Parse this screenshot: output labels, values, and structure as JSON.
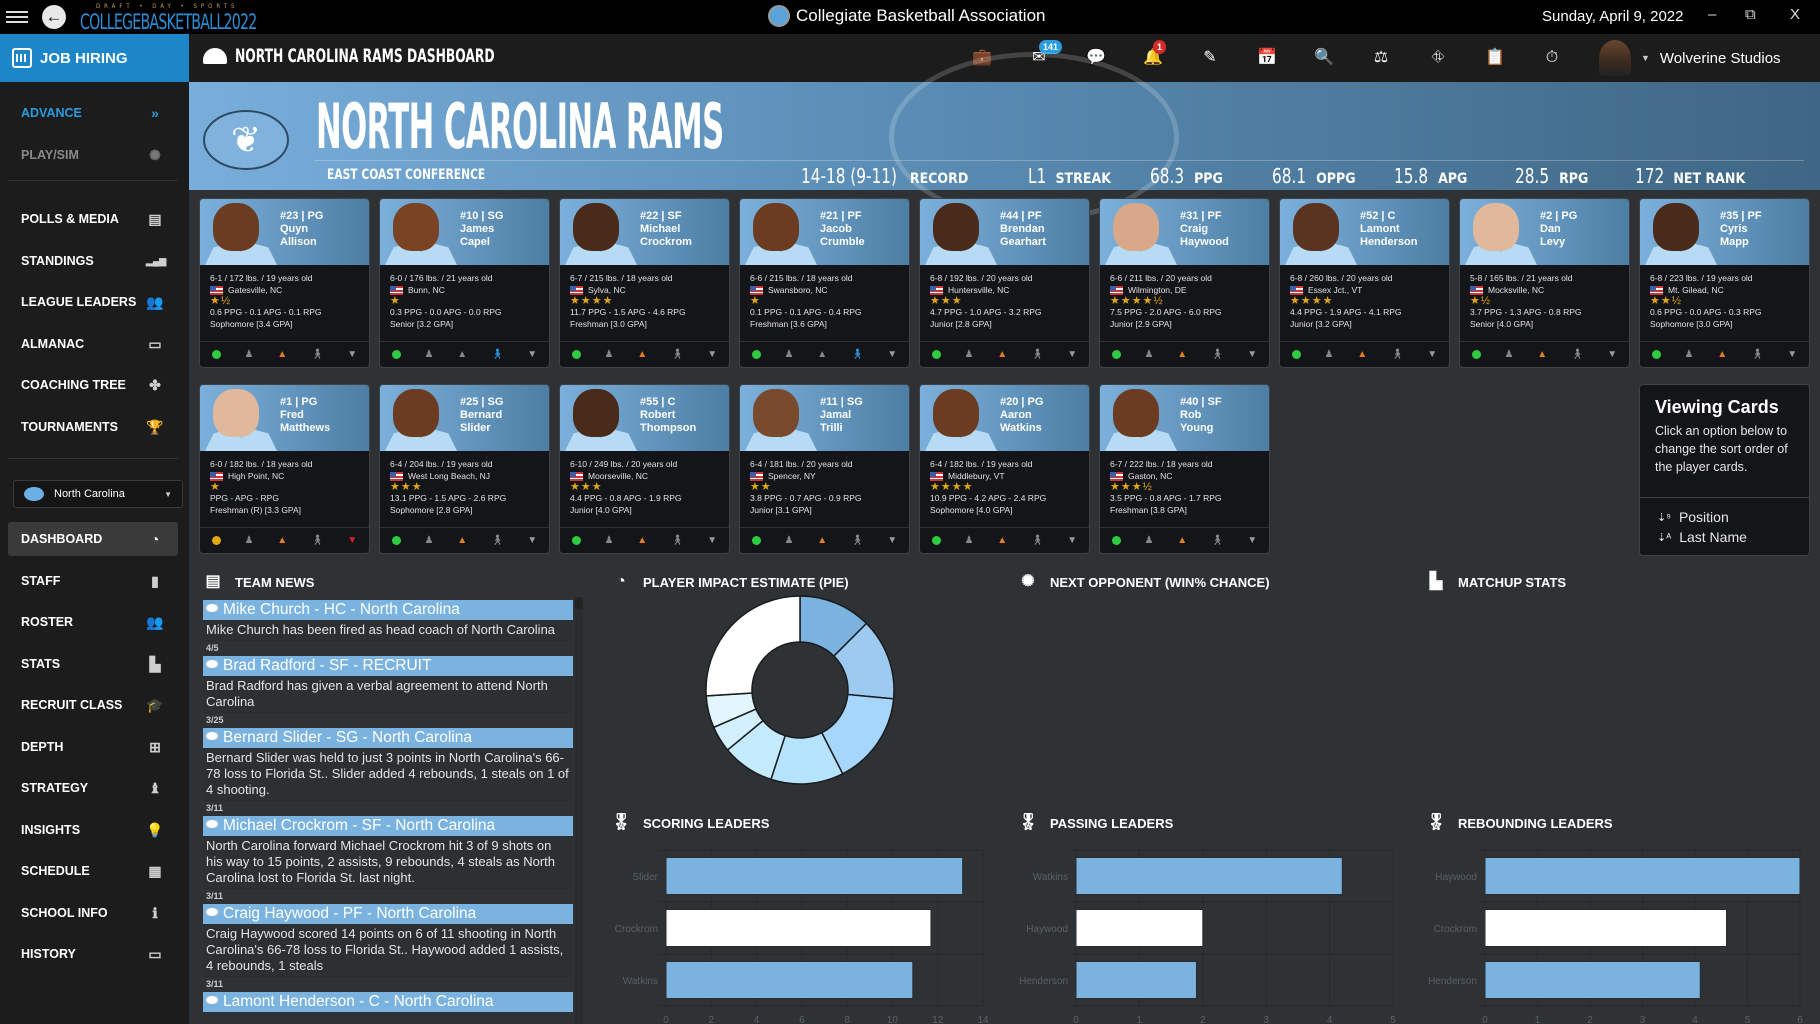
{
  "titlebar": {
    "logo_sup": "DRAFT • DAY • SPORTS",
    "logo_main": "COLLEGEBASKETBALL2022",
    "app_title": "Collegiate Basketball Association",
    "date": "Sunday, April 9, 2022",
    "minimize": "–",
    "restore": "⧉",
    "close": "X"
  },
  "job_hiring": {
    "label": "JOB HIRING"
  },
  "topnav": {
    "title": "NORTH CAROLINA RAMS DASHBOARD",
    "icons": [
      "briefcase-icon",
      "mail-icon",
      "chat-icon",
      "bell-icon",
      "edit-icon",
      "calendar-check-icon",
      "search-icon",
      "scales-icon",
      "road-icon",
      "clipboard-icon",
      "stopwatch-icon"
    ],
    "mail_badge": "141",
    "bell_badge": "1",
    "user_name": "Wolverine Studios",
    "user_caret": "▼"
  },
  "sidebar": {
    "top_items": [
      {
        "label": "ADVANCE",
        "icon": "»"
      },
      {
        "label": "PLAY/SIM",
        "icon": "✺"
      }
    ],
    "league_items": [
      {
        "label": "POLLS & MEDIA",
        "icon": "▤"
      },
      {
        "label": "STANDINGS",
        "icon": "▂▄▆"
      },
      {
        "label": "LEAGUE LEADERS",
        "icon": "👥"
      },
      {
        "label": "ALMANAC",
        "icon": "▭"
      },
      {
        "label": "COACHING TREE",
        "icon": "✤"
      },
      {
        "label": "TOURNAMENTS",
        "icon": "🏆"
      }
    ],
    "team_select": "North Carolina",
    "team_items": [
      {
        "label": "DASHBOARD",
        "icon": "◔"
      },
      {
        "label": "STAFF",
        "icon": "▮"
      },
      {
        "label": "ROSTER",
        "icon": "👥"
      },
      {
        "label": "STATS",
        "icon": "▙"
      },
      {
        "label": "RECRUIT CLASS",
        "icon": "🎓"
      },
      {
        "label": "DEPTH",
        "icon": "⊞"
      },
      {
        "label": "STRATEGY",
        "icon": "♝"
      },
      {
        "label": "INSIGHTS",
        "icon": "💡"
      },
      {
        "label": "SCHEDULE",
        "icon": "▦"
      },
      {
        "label": "SCHOOL INFO",
        "icon": "ℹ"
      },
      {
        "label": "HISTORY",
        "icon": "▭"
      }
    ]
  },
  "banner": {
    "team_name": "NORTH CAROLINA RAMS",
    "conference": "EAST COAST CONFERENCE",
    "stats": [
      {
        "value": "14-18 (9-11)",
        "label": "RECORD"
      },
      {
        "value": "L1",
        "label": "STREAK"
      },
      {
        "value": "68.3",
        "label": "PPG"
      },
      {
        "value": "68.1",
        "label": "OPPG"
      },
      {
        "value": "15.8",
        "label": "APG"
      },
      {
        "value": "28.5",
        "label": "RPG"
      },
      {
        "value": "172",
        "label": "NET RANK"
      }
    ]
  },
  "players": [
    {
      "num_pos": "#23 | PG",
      "first": "Quyn",
      "last": "Allison",
      "bio": "6-1 / 172 lbs. / 19 years old",
      "home": "Gatesville, NC",
      "stars": "★½",
      "stats": "0.6 PPG - 0.1 APG - 0.1 RPG",
      "class": "Sophomore [3.4 GPA]",
      "mood": "#2ecc40",
      "grad": "#e67e22",
      "walk": "#888",
      "shirt": "#999",
      "skin": "#6b3c22"
    },
    {
      "num_pos": "#10 | SG",
      "first": "James",
      "last": "Capel",
      "bio": "6-0 / 176 lbs. / 21 years old",
      "home": "Bunn, NC",
      "stars": "★",
      "stats": "0.3 PPG - 0.0 APG - 0.0 RPG",
      "class": "Senior [3.2 GPA]",
      "mood": "#2ecc40",
      "grad": "#888",
      "walk": "#2a8fd6",
      "shirt": "#999",
      "skin": "#7a4424"
    },
    {
      "num_pos": "#22 | SF",
      "first": "Michael",
      "last": "Crockrom",
      "bio": "6-7 / 215 lbs. / 18 years old",
      "home": "Sylva, NC",
      "stars": "★★★★",
      "stats": "11.7 PPG - 1.5 APG - 4.6 RPG",
      "class": "Freshman [3.0 GPA]",
      "mood": "#2ecc40",
      "grad": "#e67e22",
      "walk": "#888",
      "shirt": "#999",
      "skin": "#4a2a18"
    },
    {
      "num_pos": "#21 | PF",
      "first": "Jacob",
      "last": "Crumble",
      "bio": "6-6 / 215 lbs. / 18 years old",
      "home": "Swansboro, NC",
      "stars": "★",
      "stats": "0.1 PPG - 0.1 APG - 0.4 RPG",
      "class": "Freshman [3.6 GPA]",
      "mood": "#2ecc40",
      "grad": "#888",
      "walk": "#2a8fd6",
      "shirt": "#999",
      "skin": "#6b3c22"
    },
    {
      "num_pos": "#44 | PF",
      "first": "Brendan",
      "last": "Gearhart",
      "bio": "6-8 / 192 lbs. / 20 years old",
      "home": "Huntersville, NC",
      "stars": "★★★",
      "stats": "4.7 PPG - 1.0 APG - 3.2 RPG",
      "class": "Junior [2.8 GPA]",
      "mood": "#2ecc40",
      "grad": "#e67e22",
      "walk": "#888",
      "shirt": "#999",
      "skin": "#4a2a18"
    },
    {
      "num_pos": "#31 | PF",
      "first": "Craig",
      "last": "Haywood",
      "bio": "6-6 / 211 lbs. / 20 years old",
      "home": "Wilmington, DE",
      "stars": "★★★★½",
      "stats": "7.5 PPG - 2.0 APG - 6.0 RPG",
      "class": "Junior [2.9 GPA]",
      "mood": "#2ecc40",
      "grad": "#e67e22",
      "walk": "#888",
      "shirt": "#999",
      "skin": "#d9a88a"
    },
    {
      "num_pos": "#52 | C",
      "first": "Lamont",
      "last": "Henderson",
      "bio": "6-8 / 260 lbs. / 20 years old",
      "home": "Essex Jct., VT",
      "stars": "★★★★",
      "stats": "4.4 PPG - 1.9 APG - 4.1 RPG",
      "class": "Junior [3.2 GPA]",
      "mood": "#2ecc40",
      "grad": "#e67e22",
      "walk": "#888",
      "shirt": "#999",
      "skin": "#5a3420"
    },
    {
      "num_pos": "#2 | PG",
      "first": "Dan",
      "last": "Levy",
      "bio": "5-8 / 165 lbs. / 21 years old",
      "home": "Mocksville, NC",
      "stars": "★½",
      "stats": "3.7 PPG - 1.3 APG - 0.8 RPG",
      "class": "Senior [4.0 GPA]",
      "mood": "#2ecc40",
      "grad": "#e67e22",
      "walk": "#888",
      "shirt": "#999",
      "skin": "#e0b89c"
    },
    {
      "num_pos": "#35 | PF",
      "first": "Cyris",
      "last": "Mapp",
      "bio": "6-8 / 223 lbs. / 19 years old",
      "home": "Mt. Gilead, NC",
      "stars": "★★½",
      "stats": "0.6 PPG - 0.0 APG - 0.3 RPG",
      "class": "Sophomore [3.0 GPA]",
      "mood": "#2ecc40",
      "grad": "#e67e22",
      "walk": "#888",
      "shirt": "#999",
      "skin": "#4a2a18"
    },
    {
      "num_pos": "#1 | PG",
      "first": "Fred",
      "last": "Matthews",
      "bio": "6-0 / 182 lbs. / 18 years old",
      "home": "High Point, NC",
      "stars": "★",
      "stats": "PPG - APG - RPG",
      "class": "Freshman (R) [3.3 GPA]",
      "mood": "#e2a813",
      "grad": "#e67e22",
      "walk": "#888",
      "shirt": "#e02020",
      "skin": "#e0b89c"
    },
    {
      "num_pos": "#25 | SG",
      "first": "Bernard",
      "last": "Slider",
      "bio": "6-4 / 204 lbs. / 19 years old",
      "home": "West Long Beach, NJ",
      "stars": "★★★",
      "stats": "13.1 PPG - 1.5 APG - 2.6 RPG",
      "class": "Sophomore [2.8 GPA]",
      "mood": "#2ecc40",
      "grad": "#e67e22",
      "walk": "#888",
      "shirt": "#999",
      "skin": "#6b3c22"
    },
    {
      "num_pos": "#55 | C",
      "first": "Robert",
      "last": "Thompson",
      "bio": "6-10 / 249 lbs. / 20 years old",
      "home": "Moorseville, NC",
      "stars": "★★★",
      "stats": "4.4 PPG - 0.8 APG - 1.9 RPG",
      "class": "Junior [4.0 GPA]",
      "mood": "#2ecc40",
      "grad": "#e67e22",
      "walk": "#888",
      "shirt": "#999",
      "skin": "#4a2a18"
    },
    {
      "num_pos": "#11 | SG",
      "first": "Jamal",
      "last": "Trilli",
      "bio": "6-4 / 181 lbs. / 20 years old",
      "home": "Spencer, NY",
      "stars": "★★",
      "stats": "3.8 PPG - 0.7 APG - 0.9 RPG",
      "class": "Junior [3.1 GPA]",
      "mood": "#2ecc40",
      "grad": "#e67e22",
      "walk": "#888",
      "shirt": "#999",
      "skin": "#7a4a2c"
    },
    {
      "num_pos": "#20 | PG",
      "first": "Aaron",
      "last": "Watkins",
      "bio": "6-4 / 182 lbs. / 19 years old",
      "home": "Middlebury, VT",
      "stars": "★★★★",
      "stats": "10.9 PPG - 4.2 APG - 2.4 RPG",
      "class": "Sophomore [4.0 GPA]",
      "mood": "#2ecc40",
      "grad": "#e67e22",
      "walk": "#888",
      "shirt": "#999",
      "skin": "#6b3c22"
    },
    {
      "num_pos": "#40 | SF",
      "first": "Rob",
      "last": "Young",
      "bio": "6-7 / 222 lbs. / 18 years old",
      "home": "Gaston, NC",
      "stars": "★★★½",
      "stats": "3.5 PPG - 0.8 APG - 1.7 RPG",
      "class": "Freshman [3.8 GPA]",
      "mood": "#2ecc40",
      "grad": "#e67e22",
      "walk": "#888",
      "shirt": "#999",
      "skin": "#6b3c22"
    }
  ],
  "viewing_cards": {
    "title": "Viewing Cards",
    "text": "Click an option below to change the sort order of the player cards.",
    "options": [
      {
        "icon": "⇣⁹",
        "label": "Position"
      },
      {
        "icon": "⇣ᴬ",
        "label": "Last Name"
      }
    ]
  },
  "sections": {
    "team_news": "TEAM NEWS",
    "pie": "PLAYER IMPACT ESTIMATE (PIE)",
    "next_opponent": "NEXT OPPONENT (WIN% CHANCE)",
    "matchup": "MATCHUP STATS",
    "scoring": "SCORING LEADERS",
    "passing": "PASSING LEADERS",
    "rebounding": "REBOUNDING LEADERS"
  },
  "news": [
    {
      "headline": "Mike Church - HC - North Carolina",
      "body": "Mike Church has been fired as head coach of North Carolina",
      "date": "4/5"
    },
    {
      "headline": "Brad Radford - SF - RECRUIT",
      "body": "Brad Radford has given a verbal agreement to attend North Carolina",
      "date": "3/25"
    },
    {
      "headline": "Bernard Slider - SG - North Carolina",
      "body": "Bernard Slider was held to just 3 points in North Carolina's 66-78 loss to Florida St.. Slider added 4 rebounds, 1 steals on 1 of 4 shooting.",
      "date": "3/11"
    },
    {
      "headline": "Michael Crockrom - SF - North Carolina",
      "body": "North Carolina forward Michael Crockrom hit 3 of 9 shots on his way to 15 points, 2 assists, 9 rebounds, 4 steals as North Carolina lost to Florida St. last night.",
      "date": "3/11"
    },
    {
      "headline": "Craig Haywood - PF - North Carolina",
      "body": "Craig Haywood scored 14 points on 6 of 11 shooting in North Carolina's 66-78 loss to Florida St.. Haywood added 1 assists, 4 rebounds, 1 steals",
      "date": "3/11"
    },
    {
      "headline": "Lamont Henderson - C - North Carolina",
      "body": "",
      "date": ""
    }
  ],
  "chart_data": [
    {
      "type": "pie",
      "title": "PLAYER IMPACT ESTIMATE (PIE)",
      "donut": true,
      "values": [
        12.5,
        14,
        16,
        12.5,
        9,
        4.5,
        5.5,
        26
      ],
      "colors": [
        "#7ab3e0",
        "#9dcaf0",
        "#a6d6fb",
        "#b5e2fc",
        "#c3eafd",
        "#d2f0fe",
        "#e3f6fe",
        "#ffffff"
      ]
    },
    {
      "type": "bar",
      "orientation": "horizontal",
      "title": "SCORING LEADERS",
      "categories": [
        "Slider",
        "Crockrom",
        "Watkins"
      ],
      "values": [
        13.1,
        11.7,
        10.9
      ],
      "colors": [
        "#7ab3e0",
        "#ffffff",
        "#7ab3e0"
      ],
      "xlim": [
        0,
        14
      ],
      "ticks": [
        0,
        2,
        4,
        6,
        8,
        10,
        12,
        14
      ],
      "grid": true
    },
    {
      "type": "bar",
      "orientation": "horizontal",
      "title": "PASSING LEADERS",
      "categories": [
        "Watkins",
        "Haywood",
        "Henderson"
      ],
      "values": [
        4.2,
        2.0,
        1.9
      ],
      "colors": [
        "#7ab3e0",
        "#ffffff",
        "#7ab3e0"
      ],
      "xlim": [
        0,
        5
      ],
      "ticks": [
        0,
        1,
        2,
        3,
        4,
        5
      ],
      "grid": true
    },
    {
      "type": "bar",
      "orientation": "horizontal",
      "title": "REBOUNDING LEADERS",
      "categories": [
        "Haywood",
        "Crockrom",
        "Henderson"
      ],
      "values": [
        6.0,
        4.6,
        4.1
      ],
      "colors": [
        "#7ab3e0",
        "#ffffff",
        "#7ab3e0"
      ],
      "xlim": [
        0,
        6
      ],
      "ticks": [
        0,
        1,
        2,
        3,
        4,
        5,
        6
      ],
      "grid": true
    }
  ]
}
